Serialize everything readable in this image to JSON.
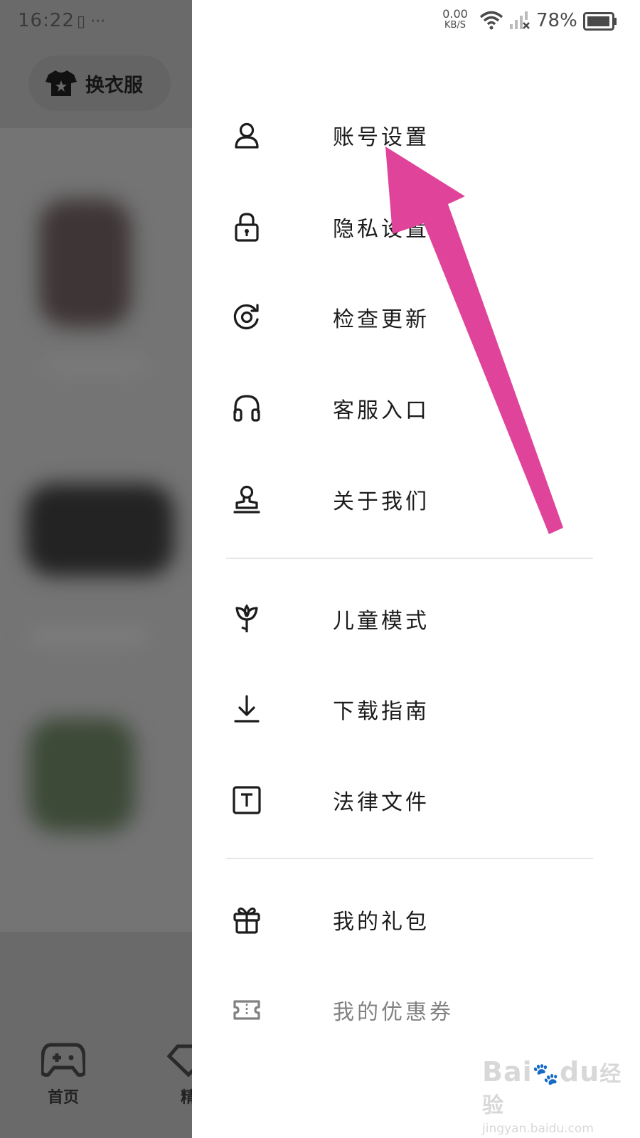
{
  "status_bar": {
    "time": "16:22",
    "extra_icons": "▯ ···",
    "net_speed_value": "0.00",
    "net_speed_unit": "KB/S",
    "battery_percent": "78%"
  },
  "background_app": {
    "change_clothes_label": "换衣服",
    "bottom_nav": {
      "home_label": "首页",
      "featured_label": "精"
    }
  },
  "drawer": {
    "section1": [
      {
        "label": "账号设置",
        "icon": "user-icon"
      },
      {
        "label": "隐私设置",
        "icon": "lock-icon"
      },
      {
        "label": "检查更新",
        "icon": "refresh-icon"
      },
      {
        "label": "客服入口",
        "icon": "headphones-icon"
      },
      {
        "label": "关于我们",
        "icon": "about-stamp-icon"
      }
    ],
    "section2": [
      {
        "label": "儿童模式",
        "icon": "sprout-icon"
      },
      {
        "label": "下载指南",
        "icon": "download-icon"
      },
      {
        "label": "法律文件",
        "icon": "text-document-icon"
      }
    ],
    "section3": [
      {
        "label": "我的礼包",
        "icon": "gift-icon"
      },
      {
        "label": "我的优惠券",
        "icon": "coupon-icon"
      }
    ]
  },
  "watermark": {
    "brand": "Bai",
    "brand_suffix": "du",
    "jingyan": "经验",
    "url": "jingyan.baidu.com"
  },
  "colors": {
    "annotation_arrow": "#e0449a",
    "dim_overlay": "#6a6a6a",
    "drawer_bg": "#ffffff",
    "text_primary": "#1c1c1c"
  }
}
